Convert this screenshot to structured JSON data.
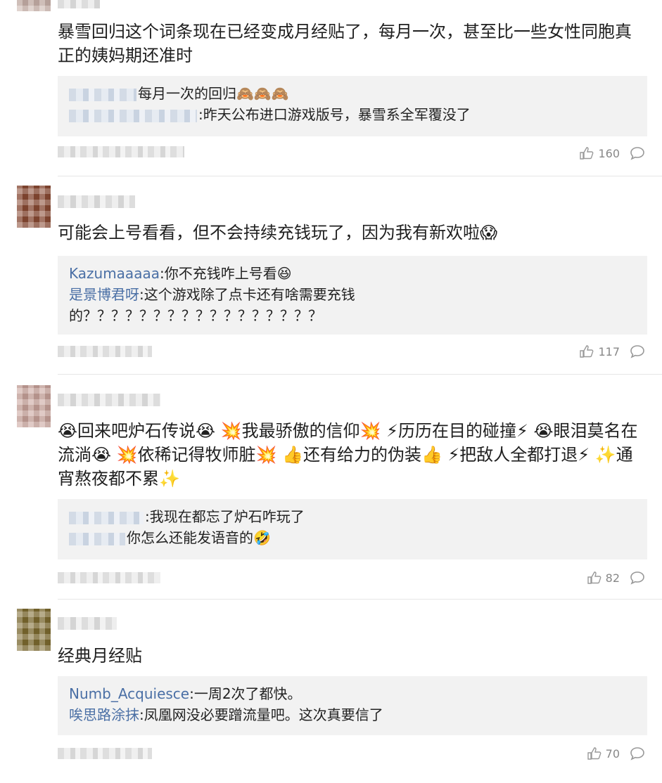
{
  "comments": [
    {
      "body": "暴雪回归这个词条现在已经变成月经贴了，每月一次，甚至比一些女性同胞真正的姨妈期还准时",
      "replies": [
        {
          "user": "",
          "text": "每月一次的回归🙈🙈🙈"
        },
        {
          "user": "",
          "text": ":昨天公布进口游戏版号，暴雪系全军覆没了"
        }
      ],
      "likes": "160"
    },
    {
      "body": "可能会上号看看，但不会持续充钱玩了，因为我有新欢啦😱",
      "replies": [
        {
          "user": "Kazumaaaaa",
          "text": ":你不充钱咋上号看😆"
        },
        {
          "user": "是景博君呀",
          "text": ":这个游戏除了点卡还有啥需要充钱的？？？？？？？？？？？？？？？？？"
        }
      ],
      "likes": "117"
    },
    {
      "body": "😭回来吧炉石传说😭 💥我最骄傲的信仰💥 ⚡历历在目的碰撞⚡ 😭眼泪莫名在流淌😭 💥依稀记得牧师脏💥 👍还有给力的伪装👍 ⚡把敌人全都打退⚡ ✨通宵熬夜都不累✨",
      "replies": [
        {
          "user": "",
          "text": ":我现在都忘了炉石咋玩了"
        },
        {
          "user": "",
          "text": "你怎么还能发语音的🤣"
        }
      ],
      "likes": "82"
    },
    {
      "body": "经典月经贴",
      "replies": [
        {
          "user": "Numb_Acquiesce",
          "text": ":一周2次了都快。"
        },
        {
          "user": "唉思路涂抹",
          "text": ":凤凰网没必要蹭流量吧。这次真要信了"
        }
      ],
      "likes": "70"
    }
  ],
  "icons": {
    "like": "thumbs-up-icon",
    "reply": "comment-bubble-icon"
  },
  "colors": {
    "reply_user": "#4a6fa5",
    "reply_bg": "#f2f2f2",
    "meta": "#888888"
  }
}
